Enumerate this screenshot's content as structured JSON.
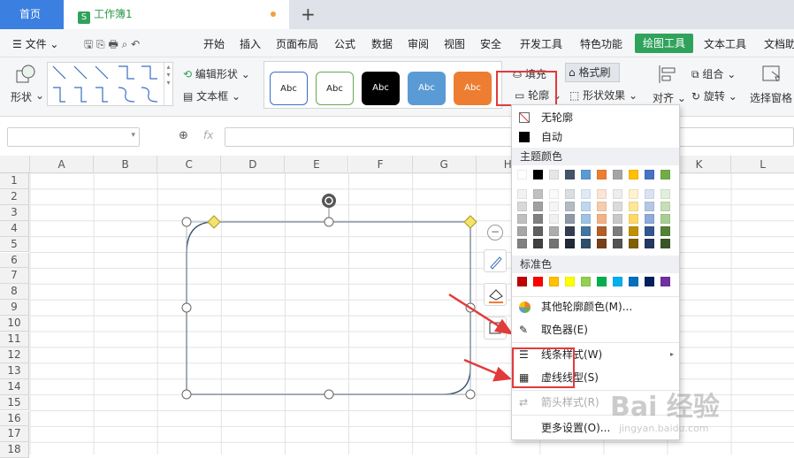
{
  "tabs": {
    "home": "首页",
    "doc": "工作簿1",
    "doc_icon": "S",
    "new_tab": "+"
  },
  "menu": {
    "file": "文件",
    "items": [
      "开始",
      "插入",
      "页面布局",
      "公式",
      "数据",
      "审阅",
      "视图",
      "安全",
      "开发工具",
      "特色功能",
      "绘图工具",
      "文本工具",
      "文档助"
    ],
    "active": "绘图工具"
  },
  "toolbar": {
    "shape": "形状",
    "edit_shape": "编辑形状",
    "textbox": "文本框",
    "style_label": "Abc",
    "fill": "填充",
    "format_brush": "格式刷",
    "outline": "轮廓",
    "shape_effect": "形状效果",
    "align": "对齐",
    "group": "组合",
    "rotate": "旋转",
    "select_pane": "选择窗格"
  },
  "formula": {
    "fx": "fx"
  },
  "grid": {
    "columns": [
      "A",
      "B",
      "C",
      "D",
      "E",
      "F",
      "G",
      "H",
      "I",
      "J",
      "K",
      "L"
    ],
    "rows": [
      "1",
      "2",
      "3",
      "4",
      "5",
      "6",
      "7",
      "8",
      "9",
      "10",
      "11",
      "12",
      "13",
      "14",
      "15",
      "16",
      "17",
      "18"
    ]
  },
  "dropdown": {
    "no_outline": "无轮廓",
    "auto": "自动",
    "theme_colors": "主题颜色",
    "standard_colors": "标准色",
    "more_colors": "其他轮廓颜色(M)...",
    "eyedropper": "取色器(E)",
    "line_style": "线条样式(W)",
    "dash_style": "虚线线型(S)",
    "arrow_style": "箭头样式(R)",
    "more_settings": "更多设置(O)...",
    "theme_row": [
      "#ffffff",
      "#000000",
      "#e7e6e6",
      "#44546a",
      "#5b9bd5",
      "#ed7d31",
      "#a5a5a5",
      "#ffc000",
      "#4472c4",
      "#70ad47"
    ],
    "standard_row": [
      "#c00000",
      "#ff0000",
      "#ffc000",
      "#ffff00",
      "#92d050",
      "#00b050",
      "#00b0f0",
      "#0070c0",
      "#002060",
      "#7030a0"
    ]
  },
  "watermark": {
    "text": "Bai 经验",
    "sub": "jingyan.baidu.com"
  }
}
